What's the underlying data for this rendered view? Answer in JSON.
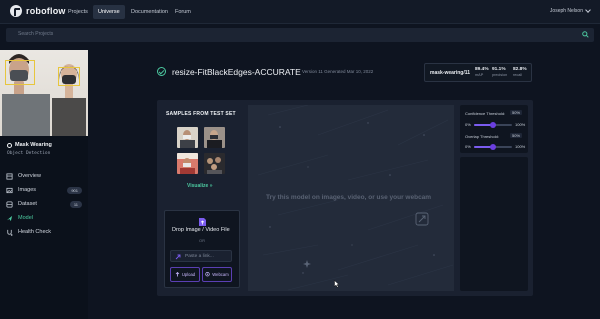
{
  "brand": {
    "name": "roboflow"
  },
  "nav": {
    "projects": "Projects",
    "universe": "Universe",
    "documentation": "Documentation",
    "forum": "Forum"
  },
  "user": {
    "name": "Joseph Nelson"
  },
  "search": {
    "placeholder": "Search Projects"
  },
  "project": {
    "name": "Mask Wearing",
    "type": "Object Detection"
  },
  "sidebar": {
    "items": [
      {
        "label": "Overview",
        "icon": "overview-icon"
      },
      {
        "label": "Images",
        "icon": "images-icon",
        "badge": "901"
      },
      {
        "label": "Dataset",
        "icon": "dataset-icon",
        "badge": "11"
      },
      {
        "label": "Model",
        "icon": "model-icon"
      },
      {
        "label": "Health Check",
        "icon": "health-check-icon"
      }
    ]
  },
  "model": {
    "title": "resize-FitBlackEdges-ACCURATE",
    "meta": "Version 11 Generated Mar 10, 2022",
    "metrics_name": "mask-wearing/11",
    "map_value": "89.4%",
    "map_label": "mAP",
    "precision_value": "91.1%",
    "precision_label": "precision",
    "recall_value": "82.8%",
    "recall_label": "recall"
  },
  "samples": {
    "title": "SAMPLES FROM TEST SET",
    "visualize": "Visualize »"
  },
  "upload": {
    "drop_title": "Drop Image / Video File",
    "or": "OR",
    "link_placeholder": "Paste a link...",
    "upload_label": "Upload",
    "webcam_label": "Webcam"
  },
  "canvas": {
    "prompt": "Try this model on images, video, or use your webcam"
  },
  "settings": {
    "confidence_label": "Confidence Threshold:",
    "confidence_value": "50%",
    "confidence_level": 0.5,
    "overlap_label": "Overlap Threshold:",
    "overlap_value": "50%",
    "overlap_level": 0.5,
    "min": "0%",
    "max": "100%"
  },
  "colors": {
    "accent": "#4cc9a0",
    "purple": "#6b3fe0",
    "background": "#0e1420"
  }
}
